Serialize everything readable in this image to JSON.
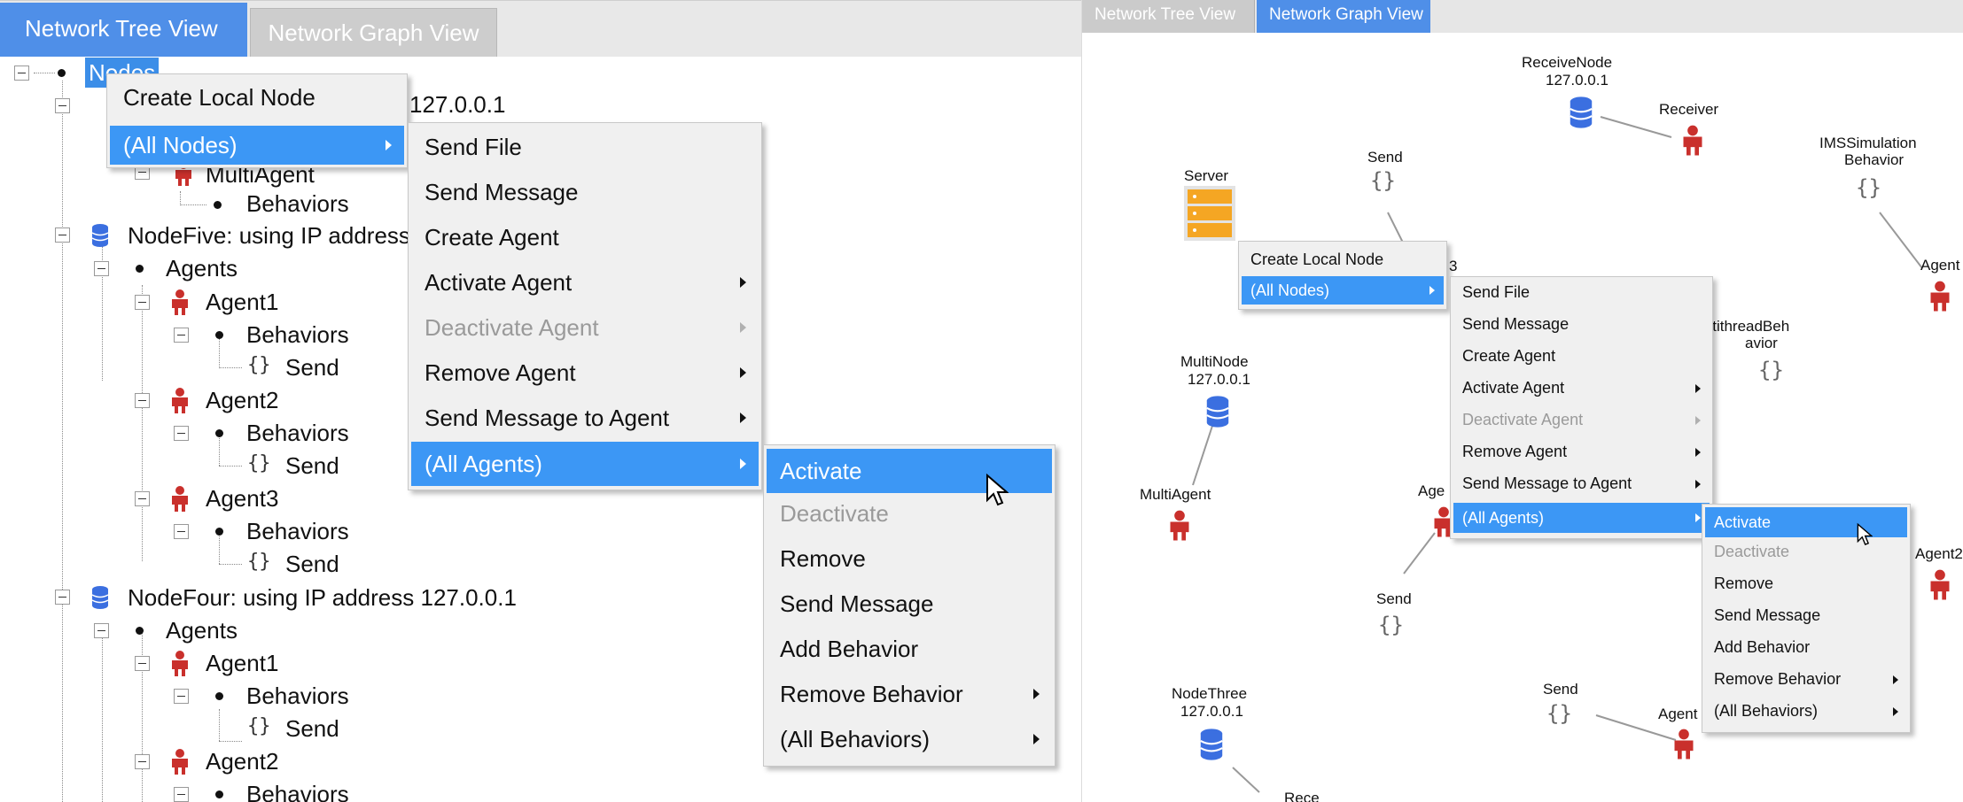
{
  "left": {
    "tabs": {
      "tree": "Network Tree View",
      "graph": "Network Graph View"
    },
    "tree": {
      "root": "Nodes",
      "node_partial_ip": "127.0.0.1",
      "multi_agent": "MultiAgent",
      "behaviors": "Behaviors",
      "node_five": "NodeFive:  using IP address",
      "agents": "Agents",
      "agent1": "Agent1",
      "agent2": "Agent2",
      "agent3": "Agent3",
      "send": "Send",
      "node_four": "NodeFour:  using IP address 127.0.0.1"
    },
    "menu1": [
      "Create Local Node",
      "(All Nodes)"
    ],
    "menu2": [
      "Send File",
      "Send Message",
      "Create Agent",
      "Activate Agent",
      "Deactivate Agent",
      "Remove Agent",
      "Send Message to Agent",
      "(All Agents)"
    ],
    "menu3": [
      "Activate",
      "Deactivate",
      "Remove",
      "Send Message",
      "Add Behavior",
      "Remove Behavior",
      "(All Behaviors)"
    ]
  },
  "right": {
    "tabs": {
      "tree": "Network Tree View",
      "graph": "Network Graph View"
    },
    "graph": {
      "receive_node": "ReceiveNode",
      "receive_ip": "127.0.0.1",
      "receiver": "Receiver",
      "send": "Send",
      "server": "Server",
      "ims_line1": "IMSSimulation",
      "ims_line2": "Behavior",
      "agent": "Agent",
      "multithread1": "ultithreadBeh",
      "multithread2": "avior",
      "multi_node": "MultiNode",
      "multi_node_ip": "127.0.0.1",
      "multi_agent": "MultiAgent",
      "age_partial": "Age",
      "agent2_partial": "Agent2",
      "node_three": "NodeThree",
      "node_three_ip": "127.0.0.1",
      "bottom_partial": "Rece",
      "edge_partial": "3"
    },
    "menu1": [
      "Create Local Node",
      "(All Nodes)"
    ],
    "menu2": [
      "Send File",
      "Send Message",
      "Create Agent",
      "Activate Agent",
      "Deactivate Agent",
      "Remove Agent",
      "Send Message to Agent",
      "(All Agents)"
    ],
    "menu3": [
      "Activate",
      "Deactivate",
      "Remove",
      "Send Message",
      "Add Behavior",
      "Remove Behavior",
      "(All Behaviors)"
    ]
  },
  "colors": {
    "selection": "#3c97f5",
    "tab_active": "#4f8fe8",
    "agent_red": "#c9302c",
    "database_blue": "#3b6fe0",
    "server_orange": "#f5a623"
  }
}
